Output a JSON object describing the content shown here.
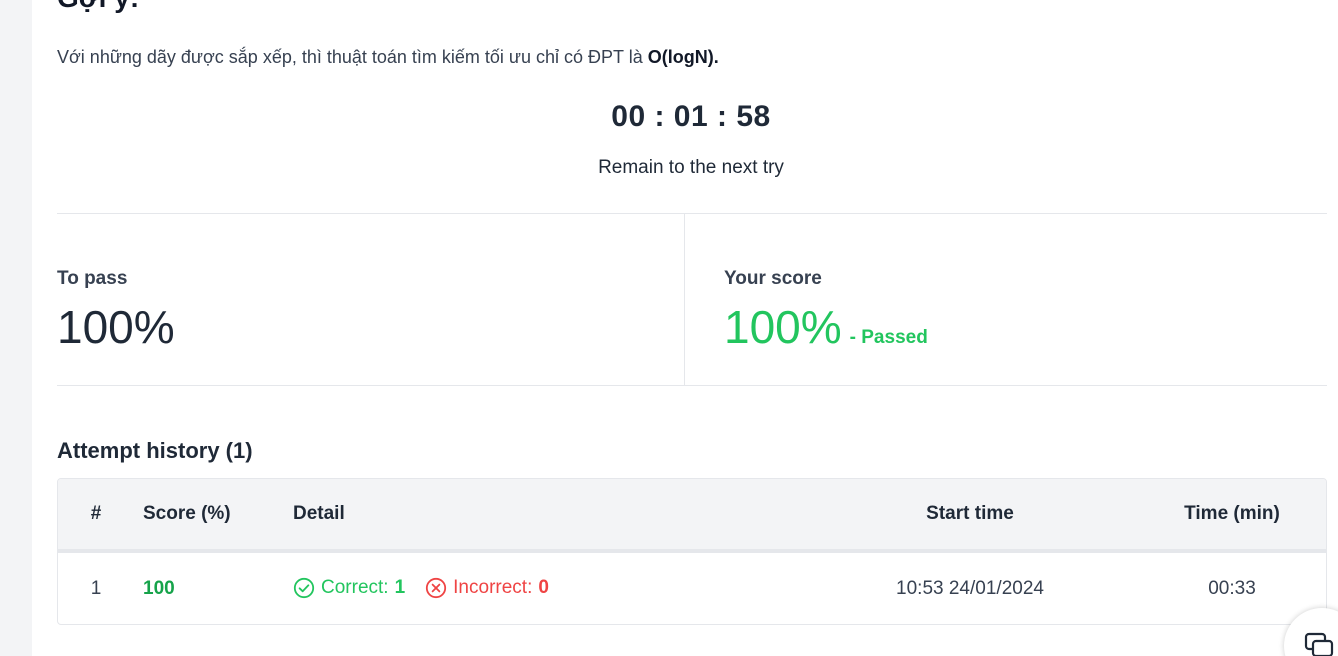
{
  "hint": {
    "title": "Gợi ý:",
    "text": "Với những dãy được sắp xếp, thì thuật toán tìm kiếm tối ưu chỉ có ĐPT là ",
    "text_bold": "O(logN)."
  },
  "timer": {
    "value": "00 : 01 : 58",
    "caption": "Remain to the next try"
  },
  "stats": {
    "to_pass_label": "To pass",
    "to_pass_value": "100%",
    "your_score_label": "Your score",
    "your_score_value": "100%",
    "status": "- Passed"
  },
  "history": {
    "title": "Attempt history (1)",
    "columns": [
      "#",
      "Score (%)",
      "Detail",
      "Start time",
      "Time (min)"
    ],
    "rows": [
      {
        "index": "1",
        "score": "100",
        "correct_label": "Correct:",
        "correct_count": "1",
        "incorrect_label": "Incorrect:",
        "incorrect_count": "0",
        "start_time": "10:53 24/01/2024",
        "duration": "00:33"
      }
    ]
  },
  "colors": {
    "pass_green": "#22c55e",
    "fail_red": "#ef4444"
  },
  "icons": {
    "correct": "check-circle-icon",
    "incorrect": "x-circle-icon",
    "chat": "chat-icon"
  }
}
